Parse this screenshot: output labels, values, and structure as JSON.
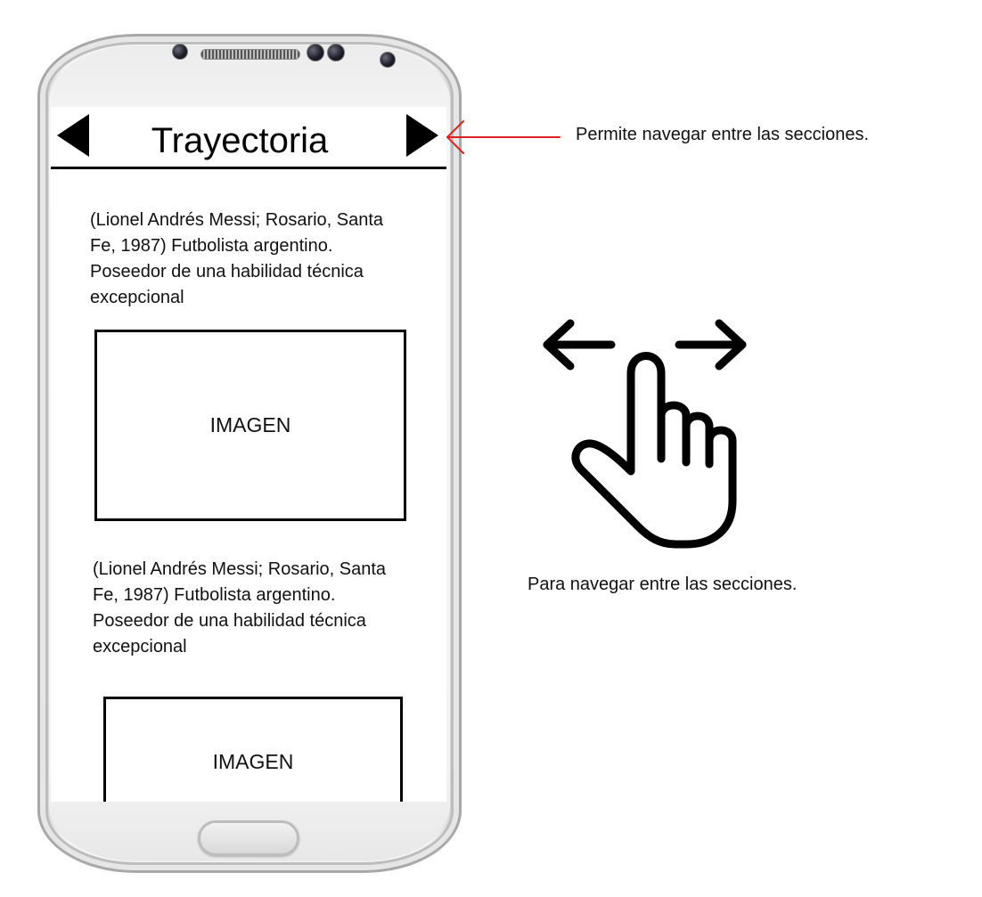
{
  "screen": {
    "title": "Trayectoria",
    "sections": [
      {
        "text": "(Lionel Andrés Messi; Rosario, Santa\nFe, 1987) Futbolista argentino.\nPoseedor de una habilidad técnica\nexcepcional",
        "image_label": "IMAGEN"
      },
      {
        "text": "(Lionel Andrés Messi; Rosario, Santa\nFe, 1987) Futbolista argentino.\nPoseedor de una habilidad técnica\nexcepcional",
        "image_label": "IMAGEN"
      }
    ]
  },
  "annotations": {
    "nav_arrows_note": "Permite navegar entre las secciones.",
    "swipe_note": "Para navegar entre las secciones."
  },
  "icons": {
    "prev": "triangle-left-icon",
    "next": "triangle-right-icon",
    "pointer": "arrow-left-icon",
    "swipe": "swipe-hand-icon"
  },
  "colors": {
    "pointer_arrow": "#e02020",
    "ink": "#000000",
    "screen_bg": "#ffffff"
  }
}
